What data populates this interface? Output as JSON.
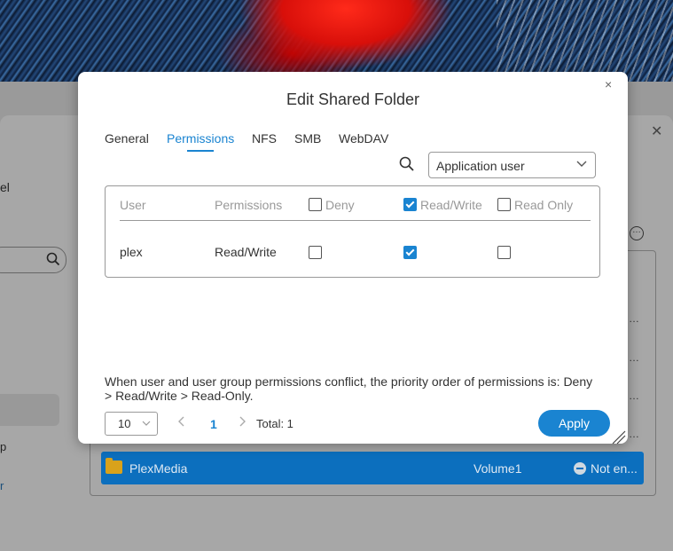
{
  "background_window": {
    "label_partial": "el",
    "glyph_partial_1": "p",
    "glyph_partial_2": "r",
    "more_icon": "ellipsis-circle-icon",
    "ellipsis": "…",
    "selected_row": {
      "name": "PlexMedia",
      "volume": "Volume1",
      "status": "Not en..."
    }
  },
  "dialog": {
    "title": "Edit Shared Folder",
    "close_icon": "×",
    "tabs": [
      {
        "label": "General",
        "active": false
      },
      {
        "label": "Permissions",
        "active": true
      },
      {
        "label": "NFS",
        "active": false
      },
      {
        "label": "SMB",
        "active": false
      },
      {
        "label": "WebDAV",
        "active": false
      }
    ],
    "user_type_select": {
      "value": "Application user"
    },
    "table": {
      "headers": {
        "user": "User",
        "permissions": "Permissions",
        "deny": "Deny",
        "read_write": "Read/Write",
        "read_only": "Read Only"
      },
      "header_checks": {
        "deny": false,
        "read_write": true,
        "read_only": false
      },
      "rows": [
        {
          "user": "plex",
          "permissions": "Read/Write",
          "deny": false,
          "read_write": true,
          "read_only": false
        }
      ]
    },
    "note": "When user and user group permissions conflict, the priority order of permissions is: Deny > Read/Write > Read-Only.",
    "pagination": {
      "page_size": "10",
      "current_page": "1",
      "total": "Total: 1"
    },
    "apply_label": "Apply"
  },
  "colors": {
    "accent": "#1a84d1",
    "selected_row": "#0c6fbe"
  }
}
